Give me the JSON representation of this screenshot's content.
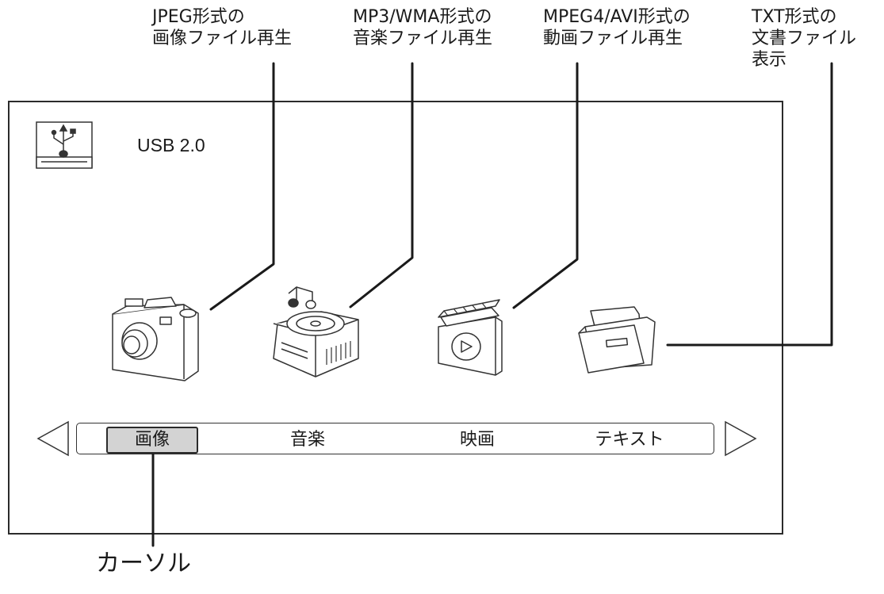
{
  "callouts": {
    "jpeg": {
      "line1": "JPEG形式の",
      "line2": "画像ファイル再生"
    },
    "mp3": {
      "line1": "MP3/WMA形式の",
      "line2": "音楽ファイル再生"
    },
    "mpeg4": {
      "line1": "MPEG4/AVI形式の",
      "line2": "動画ファイル再生"
    },
    "txt": {
      "line1": "TXT形式の",
      "line2": "文書ファイル",
      "line3": "表示"
    }
  },
  "screen": {
    "device_label": "USB 2.0",
    "device_icon": "usb-drive-icon",
    "media_icons": [
      "camera-icon",
      "music-player-icon",
      "clapperboard-icon",
      "document-folder-icon"
    ],
    "menu": {
      "left_arrow_icon": "triangle-left-icon",
      "right_arrow_icon": "triangle-right-icon",
      "items": [
        {
          "label": "画像",
          "selected": true
        },
        {
          "label": "音楽",
          "selected": false
        },
        {
          "label": "映画",
          "selected": false
        },
        {
          "label": "テキスト",
          "selected": false
        }
      ]
    }
  },
  "cursor_callout": {
    "label": "カーソル"
  },
  "colors": {
    "line": "#1a1a1a",
    "selected_bg": "#d3d3d3"
  }
}
